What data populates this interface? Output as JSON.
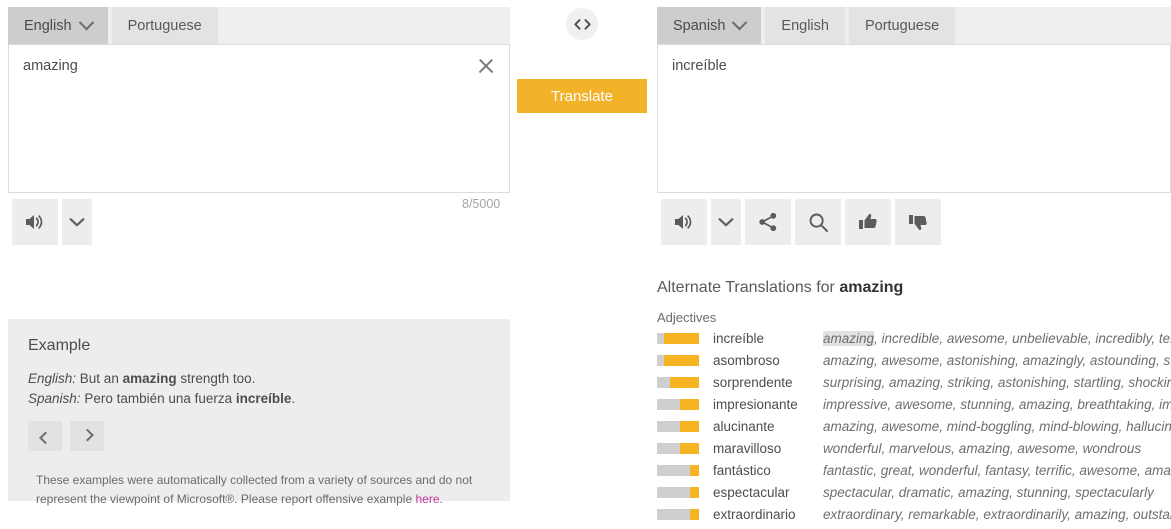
{
  "source_panel": {
    "tabs": [
      {
        "label": "English",
        "selected": true,
        "has_chevron": true
      },
      {
        "label": "Portuguese",
        "selected": false,
        "has_chevron": false
      }
    ],
    "text": "amazing",
    "counter": "8/5000",
    "clear_icon": "close-x-icon",
    "buttons": [
      {
        "icon": "speaker-icon",
        "name": "listen-button"
      },
      {
        "icon": "chevron-down-icon",
        "name": "listen-options-button"
      }
    ]
  },
  "middle": {
    "swap_icon": "swap-languages-icon",
    "translate_label": "Translate"
  },
  "target_panel": {
    "tabs": [
      {
        "label": "Spanish",
        "selected": true,
        "has_chevron": true
      },
      {
        "label": "English",
        "selected": false,
        "has_chevron": false
      },
      {
        "label": "Portuguese",
        "selected": false,
        "has_chevron": false
      }
    ],
    "text": "increíble",
    "buttons": [
      {
        "icon": "speaker-icon",
        "name": "listen-button"
      },
      {
        "icon": "chevron-down-icon",
        "name": "listen-options-button"
      },
      {
        "icon": "share-icon",
        "name": "share-button"
      },
      {
        "icon": "search-icon",
        "name": "search-button"
      },
      {
        "icon": "thumbs-up-icon",
        "name": "thumbs-up-button"
      },
      {
        "icon": "thumbs-down-icon",
        "name": "thumbs-down-button"
      }
    ]
  },
  "example": {
    "title": "Example",
    "english_label": "English:",
    "english_pre": "But an ",
    "english_bold": "amazing",
    "english_post": " strength too.",
    "spanish_label": "Spanish:",
    "spanish_pre": "Pero también una fuerza ",
    "spanish_bold": "increíble",
    "spanish_post": ".",
    "prev_icon": "chevron-left-icon",
    "next_icon": "chevron-right-icon",
    "disclaimer_pre": "These examples were automatically collected from a variety of sources and do not represent the viewpoint of Microsoft®. Please report offensive example ",
    "disclaimer_link": "here",
    "disclaimer_post": "."
  },
  "alternates": {
    "heading_prefix": "Alternate Translations for ",
    "heading_term": "amazing",
    "part_of_speech": "Adjectives",
    "rows": [
      {
        "word": "increíble",
        "confidence": 83,
        "synonyms_highlight": "amazing",
        "synonyms": ", incredible, awesome, unbelievable, incredibly, terrif"
      },
      {
        "word": "asombroso",
        "confidence": 83,
        "synonyms_highlight": "",
        "synonyms": "amazing, awesome, astonishing, amazingly, astounding, stag"
      },
      {
        "word": "sorprendente",
        "confidence": 70,
        "synonyms_highlight": "",
        "synonyms": "surprising, amazing, striking, astonishing, startling, shocking,"
      },
      {
        "word": "impresionante",
        "confidence": 45,
        "synonyms_highlight": "",
        "synonyms": "impressive, awesome, stunning, amazing, breathtaking, impr"
      },
      {
        "word": "alucinante",
        "confidence": 45,
        "synonyms_highlight": "",
        "synonyms": "amazing, awesome, mind-boggling, mind-blowing, hallucina"
      },
      {
        "word": "maravilloso",
        "confidence": 45,
        "synonyms_highlight": "",
        "synonyms": "wonderful, marvelous, amazing, awesome, wondrous"
      },
      {
        "word": "fantástico",
        "confidence": 22,
        "synonyms_highlight": "",
        "synonyms": "fantastic, great, wonderful, fantasy, terrific, awesome, amazi"
      },
      {
        "word": "espectacular",
        "confidence": 22,
        "synonyms_highlight": "",
        "synonyms": "spectacular, dramatic, amazing, stunning, spectacularly"
      },
      {
        "word": "extraordinario",
        "confidence": 22,
        "synonyms_highlight": "",
        "synonyms": "extraordinary, remarkable, extraordinarily, amazing, outstand"
      }
    ]
  },
  "colors": {
    "accent_amber": "#f2b229",
    "bar_fill": "#f6b423",
    "bar_track": "#cfcfcf",
    "tab_selected": "#cdcdcd",
    "tab_normal": "#e3e3e3",
    "link_magenta": "#c0399f"
  }
}
